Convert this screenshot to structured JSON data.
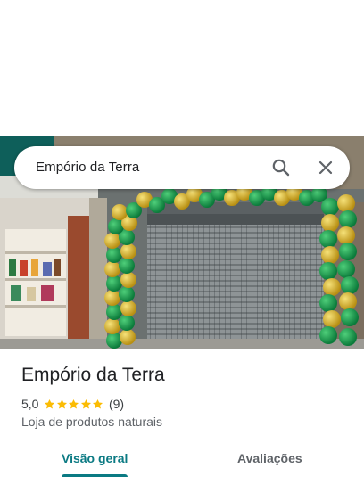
{
  "search": {
    "query": "Empório da Terra"
  },
  "icons": {
    "search": "search-icon",
    "close": "close-icon",
    "star": "star-icon"
  },
  "colors": {
    "accent": "#0b7a83",
    "star": "#fbbc04",
    "text": "#202124",
    "secondary": "#5f6368"
  },
  "place": {
    "name": "Empório da Terra",
    "rating": "5,0",
    "stars": 5,
    "review_count": "(9)",
    "category": "Loja de produtos naturais"
  },
  "tabs": [
    {
      "label": "Visão geral",
      "selected": true
    },
    {
      "label": "Avaliações",
      "selected": false
    }
  ]
}
